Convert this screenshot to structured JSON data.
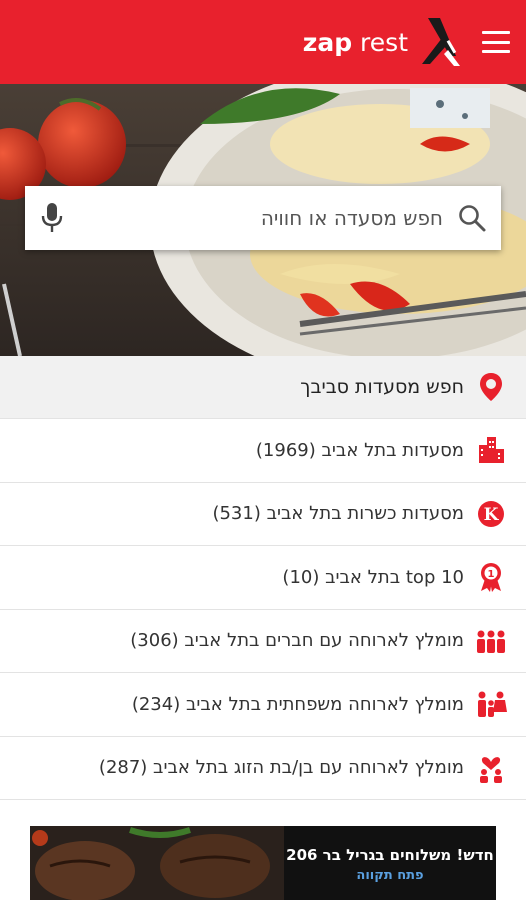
{
  "header": {
    "logo_bold": "zap",
    "logo_light": " rest",
    "menu_icon": "hamburger-menu-icon",
    "brand_color": "#e8212d"
  },
  "search": {
    "placeholder": "חפש מסעדה או חוויה",
    "search_icon": "search-icon",
    "mic_icon": "microphone-icon"
  },
  "list": {
    "nearby": {
      "label": "חפש מסעדות סביבך",
      "icon": "location-pin-icon"
    },
    "items": [
      {
        "label": "מסעדות בתל אביב (1969)",
        "icon": "city-buildings-icon"
      },
      {
        "label": "מסעדות כשרות בתל אביב (531)",
        "icon": "kosher-k-icon"
      },
      {
        "label": "top 10 בתל אביב (10)",
        "icon": "award-ribbon-icon"
      },
      {
        "label": "מומלץ לארוחה עם חברים בתל אביב (306)",
        "icon": "friends-group-icon"
      },
      {
        "label": "מומלץ לארוחה משפחתית בתל אביב (234)",
        "icon": "family-icon"
      },
      {
        "label": "מומלץ לארוחה עם בן/בת הזוג בתל אביב (287)",
        "icon": "couple-heart-icon"
      }
    ],
    "icon_color": "#e8212d"
  },
  "banner": {
    "title": "חדש! משלוחים בגריל בר 206",
    "subtitle": "פתח תקווה",
    "subtitle_color": "#5aa0e0"
  }
}
